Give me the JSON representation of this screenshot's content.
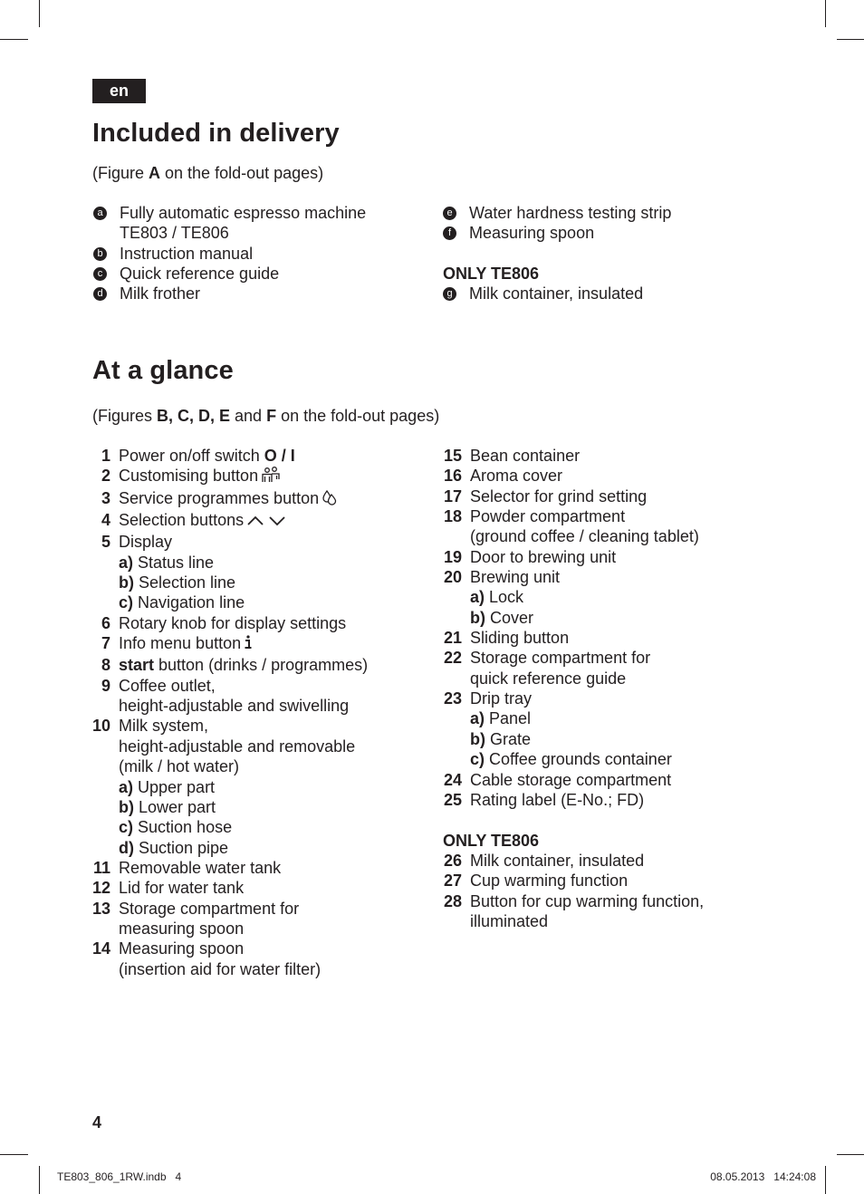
{
  "language_tab": "en",
  "delivery": {
    "title": "Included in delivery",
    "figure_ref": {
      "prefix": "(Figure ",
      "bold": "A",
      "suffix": " on the fold-out pages)"
    },
    "left_items": [
      {
        "badge": "a",
        "lines": [
          "Fully automatic espresso machine",
          "TE803 / TE806"
        ]
      },
      {
        "badge": "b",
        "lines": [
          "Instruction manual"
        ]
      },
      {
        "badge": "c",
        "lines": [
          "Quick reference guide"
        ]
      },
      {
        "badge": "d",
        "lines": [
          "Milk frother"
        ]
      }
    ],
    "right_items": [
      {
        "badge": "e",
        "lines": [
          "Water hardness testing strip"
        ]
      },
      {
        "badge": "f",
        "lines": [
          "Measuring spoon"
        ]
      }
    ],
    "only_heading": "ONLY TE806",
    "only_items": [
      {
        "badge": "g",
        "lines": [
          "Milk container, insulated"
        ]
      }
    ]
  },
  "glance": {
    "title": "At a glance",
    "figure_ref": {
      "prefix": "(Figures ",
      "bold1": "B, C, D, E",
      "mid": " and ",
      "bold2": "F",
      "suffix": " on the fold-out pages)"
    },
    "left": [
      {
        "num": "1",
        "text": "Power on/off switch ",
        "bold_suffix": "O / I"
      },
      {
        "num": "2",
        "text": "Customising button",
        "icon": "customising-people-icon"
      },
      {
        "num": "3",
        "text": "Service programmes button",
        "icon": "service-drops-icon"
      },
      {
        "num": "4",
        "text": "Selection buttons",
        "icon": "chevron-up-down-icon"
      },
      {
        "num": "5",
        "text": "Display"
      },
      {
        "sub": "a)",
        "text": "Status line"
      },
      {
        "sub": "b)",
        "text": "Selection line"
      },
      {
        "sub": "c)",
        "text": "Navigation line"
      },
      {
        "num": "6",
        "text": "Rotary knob for display settings"
      },
      {
        "num": "7",
        "text": "Info menu button",
        "icon": "info-icon"
      },
      {
        "num": "8",
        "bold_prefix": "start",
        "text": " button (drinks / programmes)"
      },
      {
        "num": "9",
        "text": "Coffee outlet,"
      },
      {
        "cont": true,
        "text": "height-adjustable and swivelling"
      },
      {
        "num": "10",
        "text": "Milk system,"
      },
      {
        "cont": true,
        "text": "height-adjustable and removable"
      },
      {
        "cont": true,
        "text": "(milk / hot water)"
      },
      {
        "sub": "a)",
        "text": "Upper part"
      },
      {
        "sub": "b)",
        "text": "Lower part"
      },
      {
        "sub": "c)",
        "text": "Suction hose"
      },
      {
        "sub": "d)",
        "text": "Suction pipe"
      },
      {
        "num": "11",
        "text": "Removable water tank"
      },
      {
        "num": "12",
        "text": "Lid for water tank"
      },
      {
        "num": "13",
        "text": "Storage compartment for"
      },
      {
        "cont": true,
        "text": "measuring spoon"
      },
      {
        "num": "14",
        "text": "Measuring spoon"
      },
      {
        "cont": true,
        "text": "(insertion aid for water filter)"
      }
    ],
    "right": [
      {
        "num": "15",
        "text": "Bean container"
      },
      {
        "num": "16",
        "text": "Aroma cover"
      },
      {
        "num": "17",
        "text": "Selector for grind setting"
      },
      {
        "num": "18",
        "text": "Powder compartment"
      },
      {
        "cont": true,
        "text": "(ground coffee / cleaning tablet)"
      },
      {
        "num": "19",
        "text": "Door to brewing unit"
      },
      {
        "num": "20",
        "text": "Brewing unit"
      },
      {
        "sub": "a)",
        "text": "Lock"
      },
      {
        "sub": "b)",
        "text": "Cover"
      },
      {
        "num": "21",
        "text": "Sliding button"
      },
      {
        "num": "22",
        "text": "Storage compartment for"
      },
      {
        "cont": true,
        "text": "quick reference guide"
      },
      {
        "num": "23",
        "text": "Drip tray"
      },
      {
        "sub": "a)",
        "text": "Panel"
      },
      {
        "sub": "b)",
        "text": "Grate"
      },
      {
        "sub": "c)",
        "text": "Coffee grounds container"
      },
      {
        "num": "24",
        "text": "Cable storage compartment"
      },
      {
        "num": "25",
        "text": "Rating label (E-No.; FD)"
      },
      {
        "gap": true
      },
      {
        "heading": "ONLY TE806"
      },
      {
        "num": "26",
        "text": "Milk container, insulated"
      },
      {
        "num": "27",
        "text": "Cup warming function"
      },
      {
        "num": "28",
        "text": "Button for cup warming function,"
      },
      {
        "cont": true,
        "text": "illuminated"
      }
    ]
  },
  "page_number": "4",
  "slug": {
    "file": "TE803_806_1RW.indb   4",
    "datetime": "08.05.2013   14:24:08"
  }
}
